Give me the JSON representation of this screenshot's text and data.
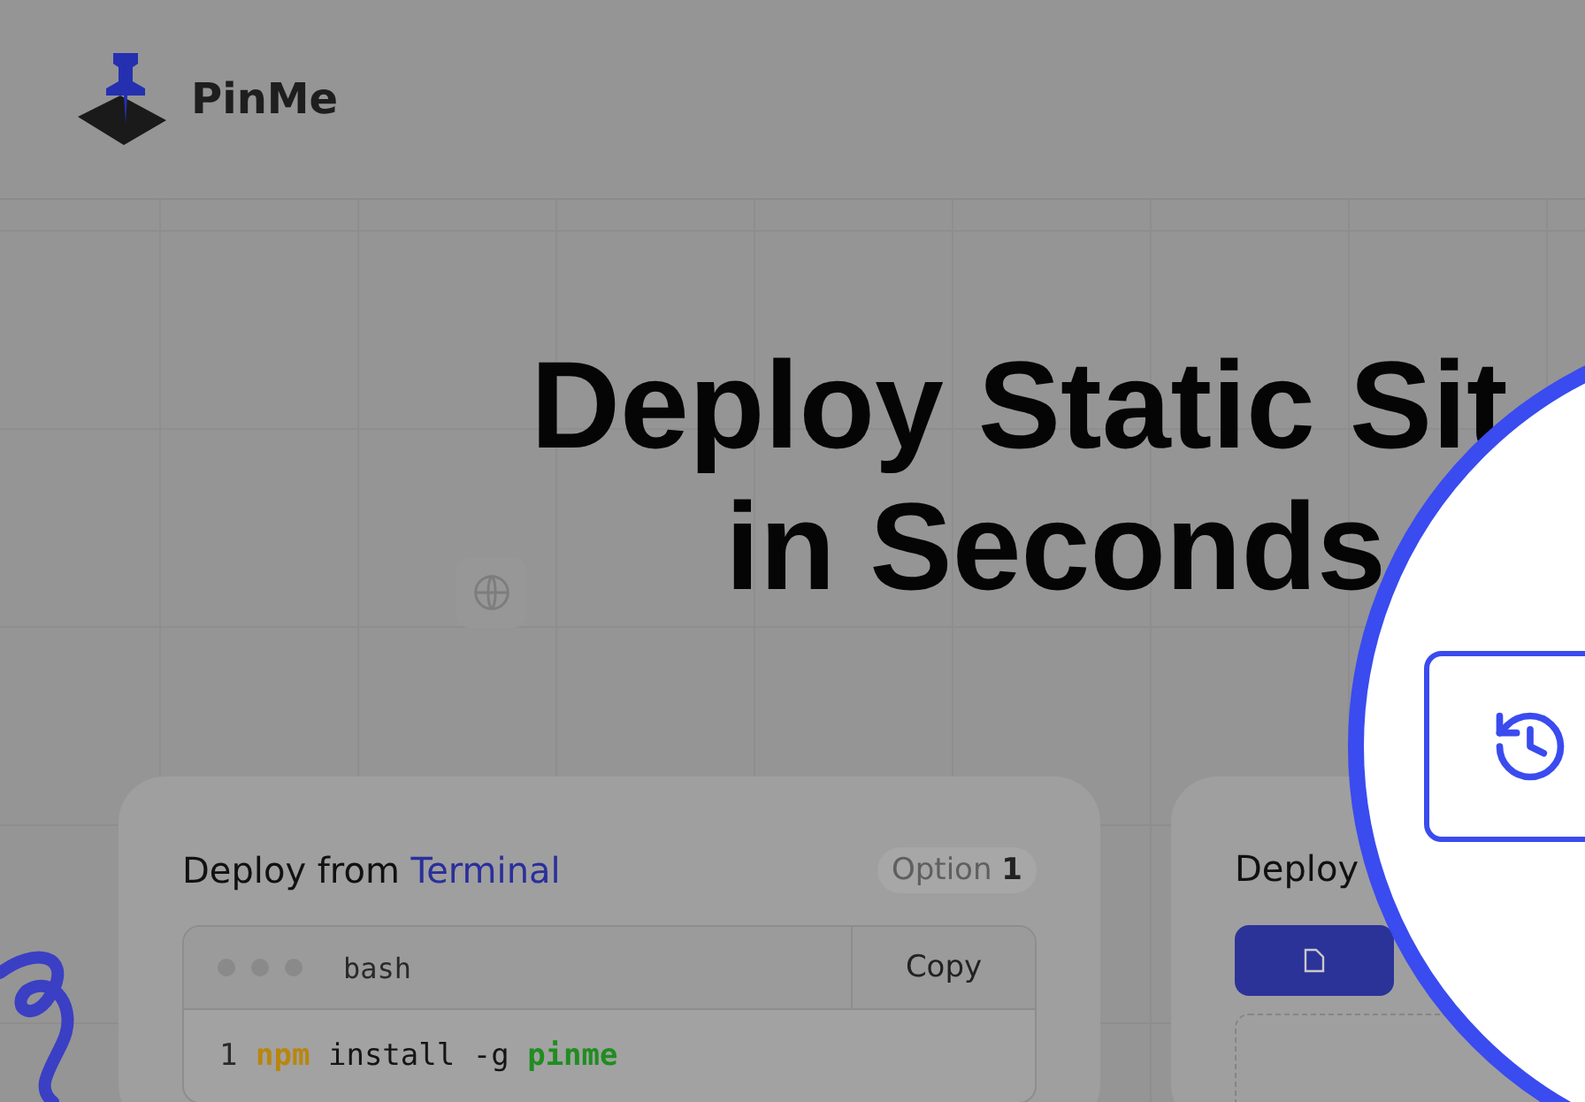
{
  "header": {
    "brand": "PinMe"
  },
  "hero": {
    "title_lines": [
      "Deploy Static Sit",
      "in Seconds"
    ]
  },
  "cards": [
    {
      "kind": "terminal",
      "title": "Deploy from",
      "title_accent": "Terminal",
      "badge_label": "Option",
      "badge_number": "1",
      "terminal": {
        "shell": "bash",
        "copy": "Copy",
        "lines": [
          {
            "number": "1",
            "tokens": [
              {
                "kind": "command",
                "text": "npm"
              },
              {
                "kind": "plain",
                "text": "install -g"
              },
              {
                "kind": "package",
                "text": "pinme"
              }
            ]
          }
        ]
      }
    },
    {
      "kind": "upload",
      "title": "Deploy"
    }
  ]
}
